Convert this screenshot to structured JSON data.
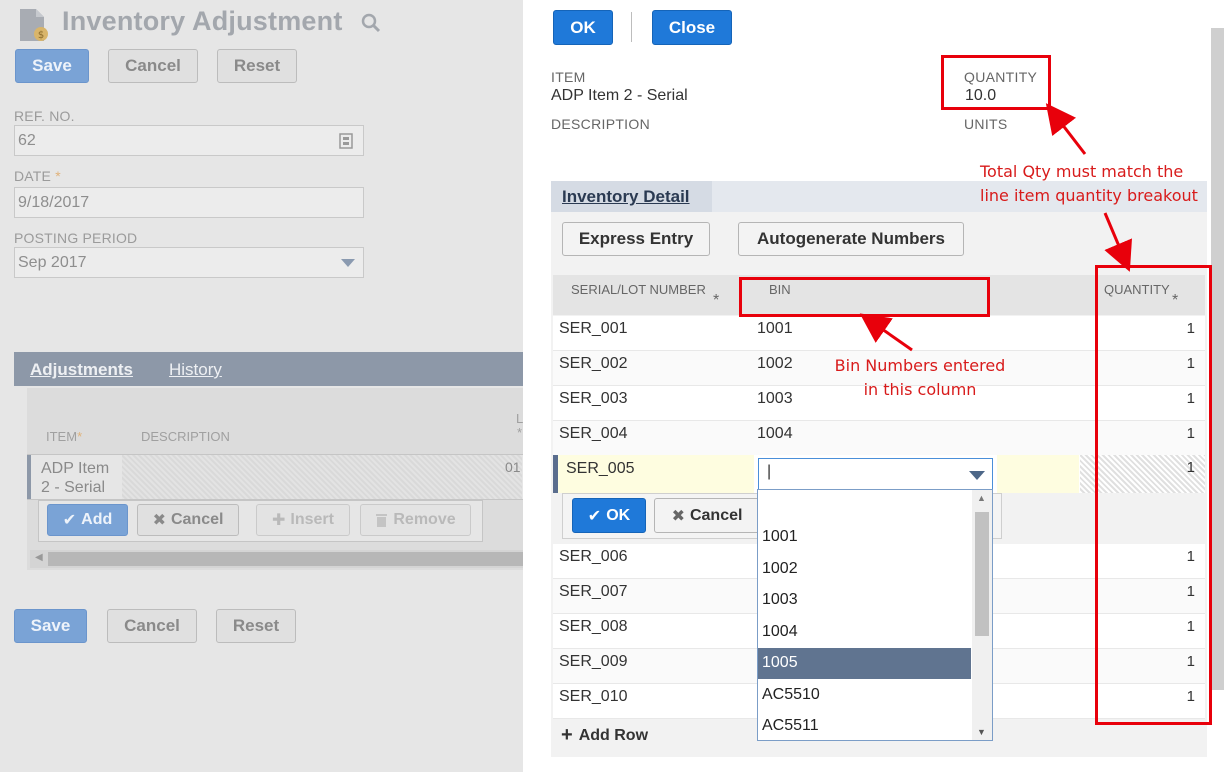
{
  "page": {
    "title": "Inventory Adjustment",
    "save": "Save",
    "cancel": "Cancel",
    "reset": "Reset",
    "ref_label": "REF. NO.",
    "ref_value": "62",
    "date_label": "DATE",
    "date_value": "9/18/2017",
    "period_label": "POSTING PERIOD",
    "period_value": "Sep 2017",
    "required_mark": "*"
  },
  "tabs": [
    "Adjustments",
    "History"
  ],
  "sublist": {
    "col_item": "ITEM",
    "col_desc": "DESCRIPTION",
    "col_partial": "L",
    "item_value": "ADP Item 2 - Serial",
    "partial_value": "01",
    "add": "Add",
    "cancel": "Cancel",
    "insert": "Insert",
    "remove": "Remove"
  },
  "popup": {
    "ok": "OK",
    "close": "Close",
    "item_label": "ITEM",
    "item_value": "ADP Item 2 - Serial",
    "desc_label": "DESCRIPTION",
    "qty_label": "QUANTITY",
    "qty_value": "10.0",
    "units_label": "UNITS",
    "detail_tab": "Inventory Detail",
    "express_entry": "Express Entry",
    "autogenerate": "Autogenerate Numbers",
    "col_serial": "SERIAL/LOT NUMBER",
    "col_bin": "BIN",
    "col_qty": "QUANTITY",
    "rows_top": [
      {
        "serial": "SER_001",
        "bin": "1001",
        "qty": "1"
      },
      {
        "serial": "SER_002",
        "bin": "1002",
        "qty": "1"
      },
      {
        "serial": "SER_003",
        "bin": "1003",
        "qty": "1"
      },
      {
        "serial": "SER_004",
        "bin": "1004",
        "qty": "1"
      }
    ],
    "edit_row": {
      "serial": "SER_005",
      "bin_input": "|",
      "qty": "1"
    },
    "row_ok": "OK",
    "row_cancel": "Cancel",
    "rows_bottom": [
      {
        "serial": "SER_006",
        "qty": "1"
      },
      {
        "serial": "SER_007",
        "qty": "1"
      },
      {
        "serial": "SER_008",
        "qty": "1"
      },
      {
        "serial": "SER_009",
        "qty": "1"
      },
      {
        "serial": "SER_010",
        "qty": "1"
      }
    ],
    "add_row": "Add Row",
    "bin_options": [
      "1001",
      "1002",
      "1003",
      "1004",
      "1005",
      "AC5510",
      "AC5511"
    ],
    "bin_selected": "1005"
  },
  "annotations": {
    "qty_line1": "Total Qty must match the",
    "qty_line2": "line item quantity breakout",
    "bin_line1": "Bin Numbers entered",
    "bin_line2": "in this column"
  },
  "colors": {
    "accent": "#1f79d9",
    "annotation": "#e8000b",
    "selected_option": "#607490"
  }
}
